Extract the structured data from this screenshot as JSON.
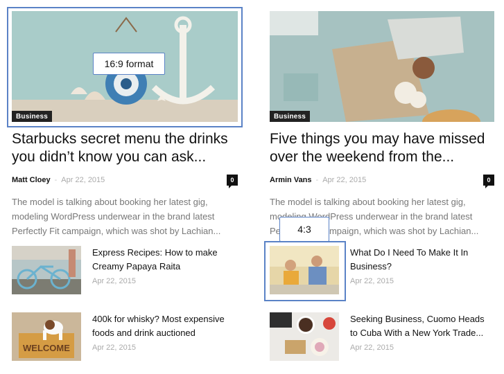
{
  "posts": {
    "left": {
      "category": "Business",
      "title": "Starbucks secret menu the drinks you didn’t know you can ask...",
      "author": "Matt Cloey",
      "separator": "-",
      "date": "Apr 22, 2015",
      "comments": "0",
      "excerpt": "The model is talking about booking her latest gig, modeling WordPress underwear in the brand latest Perfectly Fit campaign, which was shot by Lachian..."
    },
    "right": {
      "category": "Business",
      "title": "Five things you may have missed over the weekend from the...",
      "author": "Armin Vans",
      "separator": "-",
      "date": "Apr 22, 2015",
      "comments": "0",
      "excerpt": "The model is talking about booking her latest gig, modeling WordPress underwear in the brand latest Perfectly Fit campaign, which was shot by Lachian..."
    }
  },
  "small_posts": [
    {
      "title": "Express Recipes: How to make Creamy Papaya Raita",
      "date": "Apr 22, 2015"
    },
    {
      "title": "What Do I Need To Make It In Business?",
      "date": "Apr 22, 2015"
    },
    {
      "title": "400k for whisky? Most expensive foods and drink auctioned",
      "date": "Apr 22, 2015"
    },
    {
      "title": "Seeking Business, Cuomo Heads to Cuba With a New York Trade...",
      "date": "Apr 22, 2015"
    }
  ],
  "annotations": {
    "hero_format": "16:9 format",
    "thumb_format": "4:3"
  },
  "colors": {
    "annotation": "#5a82c6",
    "badge_bg": "#222222",
    "meta_gray": "#aaaaaa"
  }
}
